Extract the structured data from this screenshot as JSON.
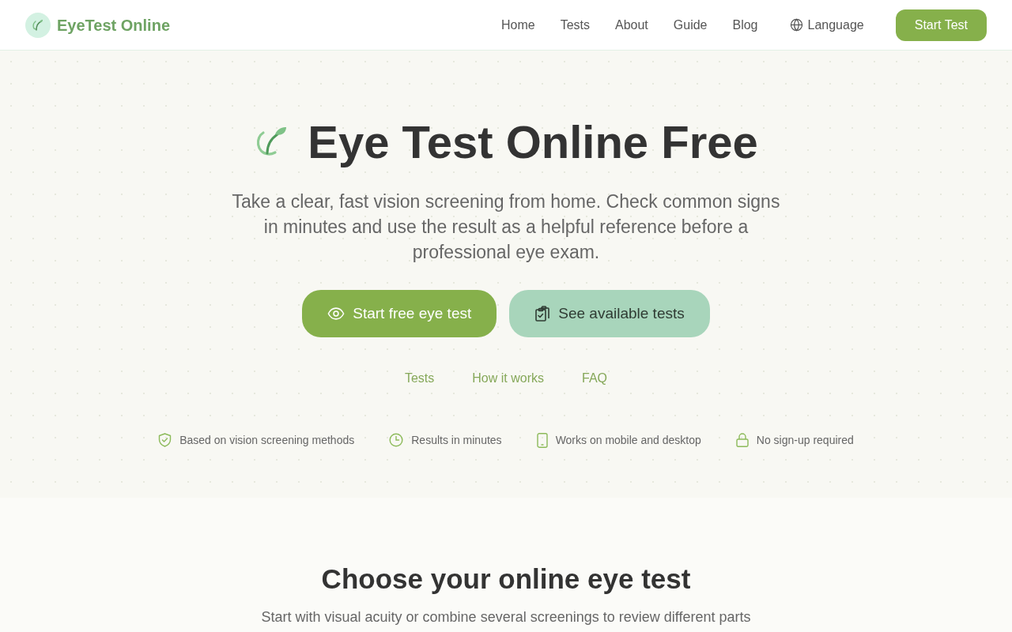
{
  "header": {
    "logo_text": "EyeTest Online",
    "nav": [
      "Home",
      "Tests",
      "About",
      "Guide",
      "Blog"
    ],
    "language": "Language",
    "cta": "Start Test"
  },
  "hero": {
    "title": "Eye Test Online Free",
    "subtitle": "Take a clear, fast vision screening from home. Check common signs in minutes and use the result as a helpful reference before a professional eye exam.",
    "buttons": [
      {
        "kind": "primary",
        "label": "Start free eye test"
      },
      {
        "kind": "secondary",
        "label": "See available tests"
      }
    ],
    "links": [
      "Tests",
      "How it works",
      "FAQ"
    ],
    "features": [
      "Based on vision screening methods",
      "Results in minutes",
      "Works on mobile and desktop",
      "No sign-up required"
    ]
  },
  "tests_section": {
    "heading": "Choose your online eye test",
    "intro": "Start with visual acuity or combine several screenings to review different parts"
  }
}
